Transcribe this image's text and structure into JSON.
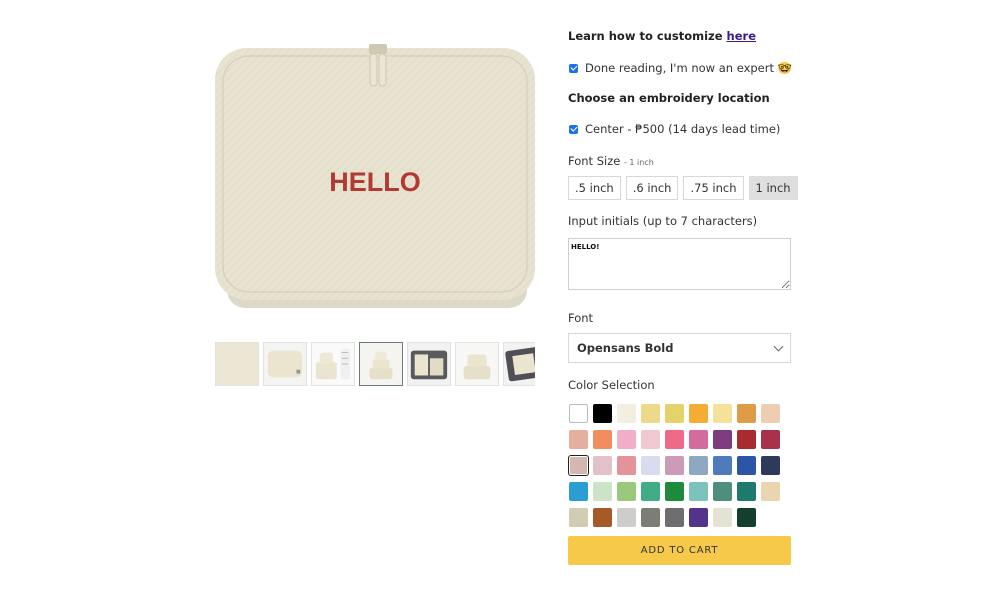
{
  "product": {
    "embroidery_text": "HELLO",
    "thumbnails": [
      "thumb-1",
      "thumb-2",
      "thumb-3",
      "thumb-4",
      "thumb-5",
      "thumb-6",
      "thumb-7"
    ],
    "active_thumbnail": 3
  },
  "customize": {
    "learn_prefix": "Learn how to customize ",
    "learn_link": "here",
    "done_reading_label": "Done reading, I'm now an expert 🤓",
    "done_reading_checked": true
  },
  "location": {
    "heading": "Choose an embroidery location",
    "option_label": "Center - ₱500 (14 days lead time)",
    "option_checked": true
  },
  "font_size": {
    "label": "Font Size",
    "selected_note": "- 1 inch",
    "options": [
      ".5 inch",
      ".6 inch",
      ".75 inch",
      "1 inch"
    ],
    "selected_index": 3
  },
  "initials": {
    "label": "Input initials (up to 7 characters)",
    "value": "HELLO!"
  },
  "font": {
    "label": "Font",
    "selected": "Opensans Bold"
  },
  "color": {
    "label": "Color Selection",
    "selected_index": 18,
    "swatches": [
      "#ffffff",
      "#000000",
      "#f3efe0",
      "#ecd98a",
      "#e4d36a",
      "#f4ad32",
      "#f5e29a",
      "#dd9c45",
      "#efcdb3",
      "#e4afa1",
      "#f28d62",
      "#f2aec8",
      "#efc8d1",
      "#ef6a86",
      "#d36c9c",
      "#7e3b7e",
      "#a82b2f",
      "#a8314b",
      "#d5b7b2",
      "#e2c1ca",
      "#e5939a",
      "#d9dcef",
      "#cc9bb8",
      "#8fa8c1",
      "#4f7bbd",
      "#2d55a6",
      "#2e3a5a",
      "#2a9ed2",
      "#cde3c8",
      "#9bc97b",
      "#40ad86",
      "#1d8a3d",
      "#7cc2bd",
      "#4d8f7c",
      "#1f7a6e",
      "#ead5b1",
      "#d2ccb2",
      "#a65a28",
      "#cdcdcc",
      "#7d7e73",
      "#6e6e70",
      "#54338c",
      "#e4e2d3",
      "#143e2e"
    ]
  },
  "cart": {
    "button_label": "ADD TO CART"
  }
}
